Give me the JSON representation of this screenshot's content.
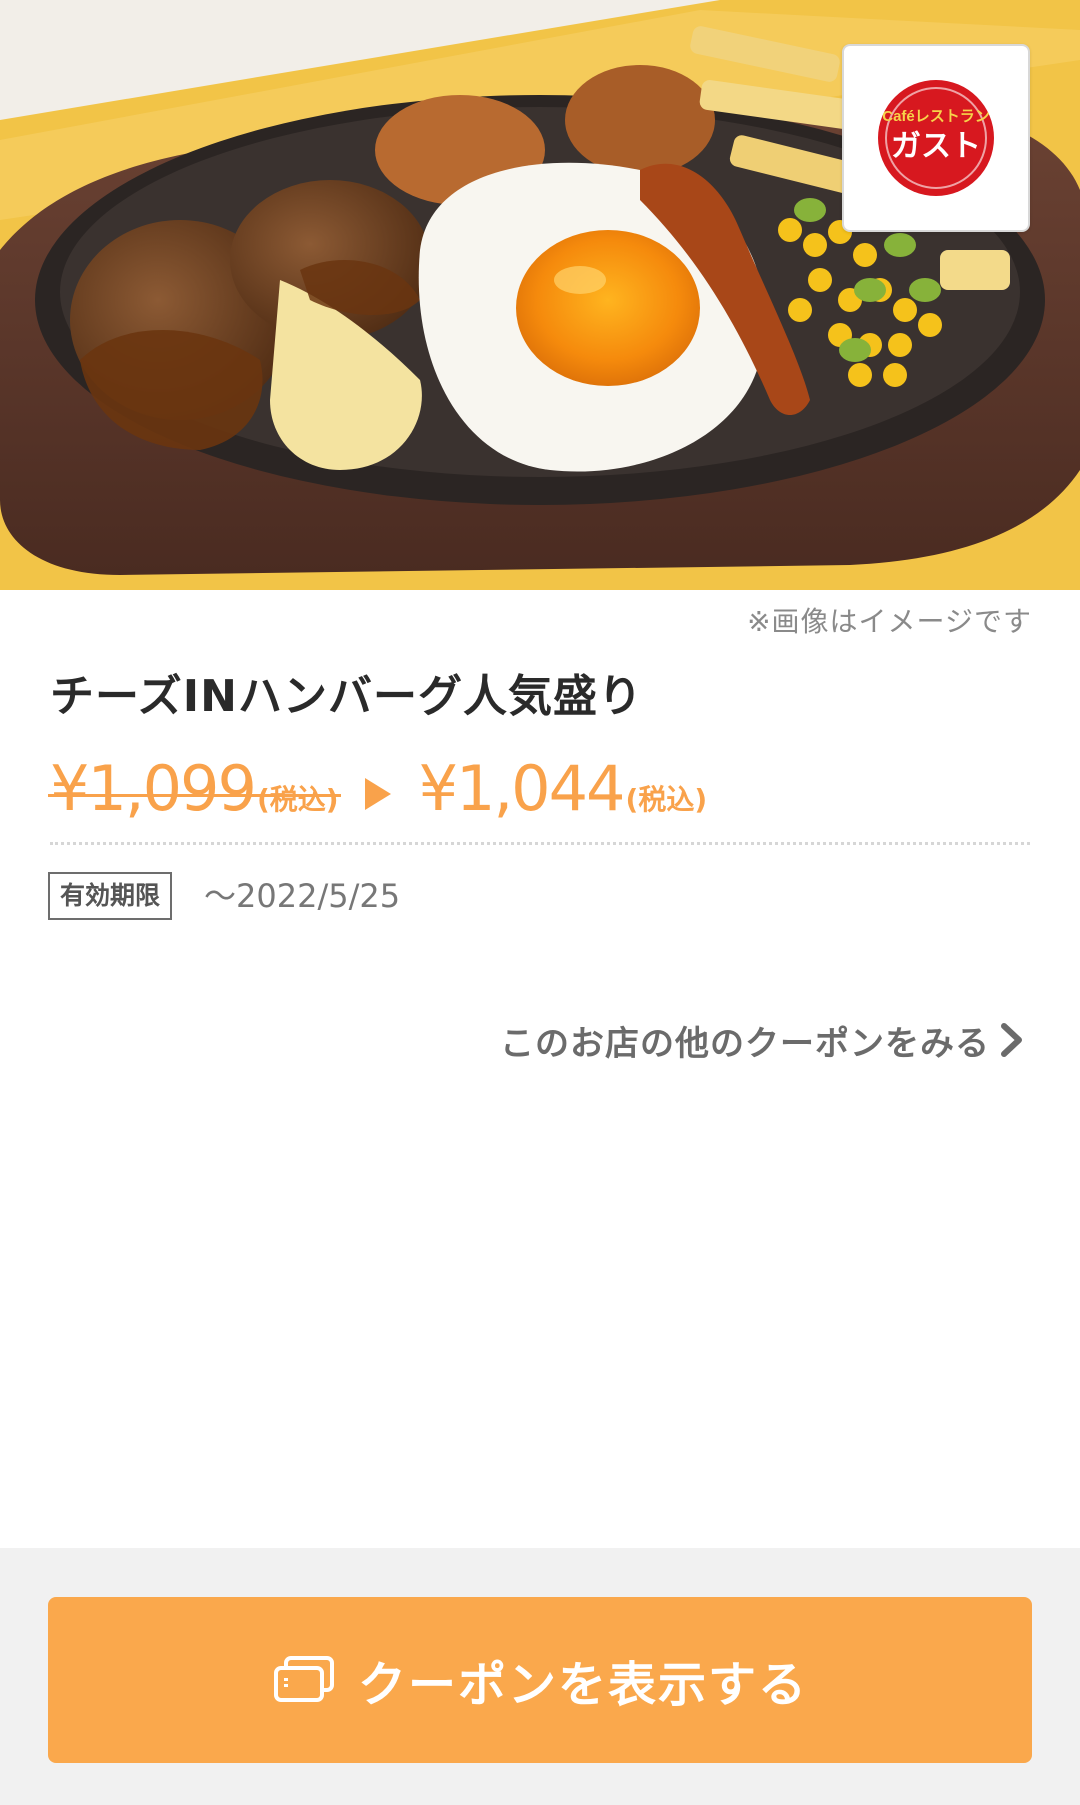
{
  "hero": {
    "image_alt": "チーズINハンバーグ人気盛り",
    "logo": {
      "brand_small": "Caféレストラン",
      "brand_main": "ガスト"
    }
  },
  "info": {
    "disclaimer": "※画像はイメージです",
    "title": "チーズINハンバーグ人気盛り",
    "price_original": "¥1,099",
    "tax_original": "(税込)",
    "price_discount": "¥1,044",
    "tax_discount": "(税込)",
    "expiry_label": "有効期限",
    "expiry_date": "〜2022/5/25"
  },
  "links": {
    "more_coupons": "このお店の他のクーポンをみる"
  },
  "footer": {
    "button_label": "クーポンを表示する"
  },
  "colors": {
    "accent": "#faa84c",
    "logo_red": "#d7181f",
    "text_dark": "#2a2a2a",
    "text_gray": "#6b6b6b",
    "footer_bg": "#f1f1f1"
  }
}
